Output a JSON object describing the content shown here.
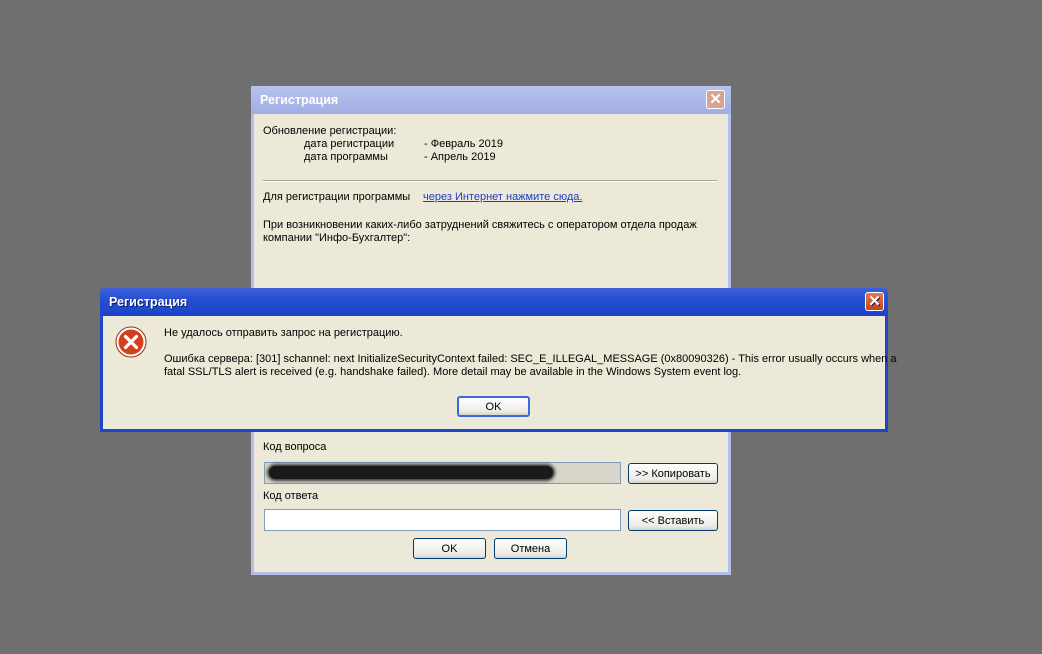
{
  "back_dialog": {
    "title": "Регистрация",
    "update_heading": "Обновление регистрации:",
    "reg_date_label": "дата регистрации",
    "reg_date_value": "- Февраль 2019",
    "prog_date_label": "дата программы",
    "prog_date_value": "- Апрель 2019",
    "register_text": "Для регистрации программы",
    "register_link": "через Интернет нажмите сюда.",
    "contact_line1": "При возникновении каких-либо затруднений свяжитесь с оператором отдела продаж",
    "contact_line2": "компании \"Инфо-Бухгалтер\":",
    "question_code_label": "Код вопроса",
    "copy_button": ">> Копировать",
    "answer_code_label": "Код ответа",
    "answer_value": "",
    "paste_button": "<< Вставить",
    "ok_button": "OK",
    "cancel_button": "Отмена"
  },
  "error_dialog": {
    "title": "Регистрация",
    "message_main": "Не удалось отправить запрос на регистрацию.",
    "message_detail_line1": "Ошибка сервера: [301] schannel: next InitializeSecurityContext failed: SEC_E_ILLEGAL_MESSAGE (0x80090326) - This error usually occurs when a",
    "message_detail_line2": "fatal SSL/TLS alert is received (e.g. handshake failed). More detail may be available in the Windows System event log.",
    "ok_button": "OK",
    "icon": "error-icon"
  },
  "colors": {
    "desktop": "#6f6f6f",
    "dialog_bg": "#ece9d8",
    "active_title": "#2550d2",
    "inactive_title": "#a2aee4",
    "link": "#1e3cc8"
  }
}
